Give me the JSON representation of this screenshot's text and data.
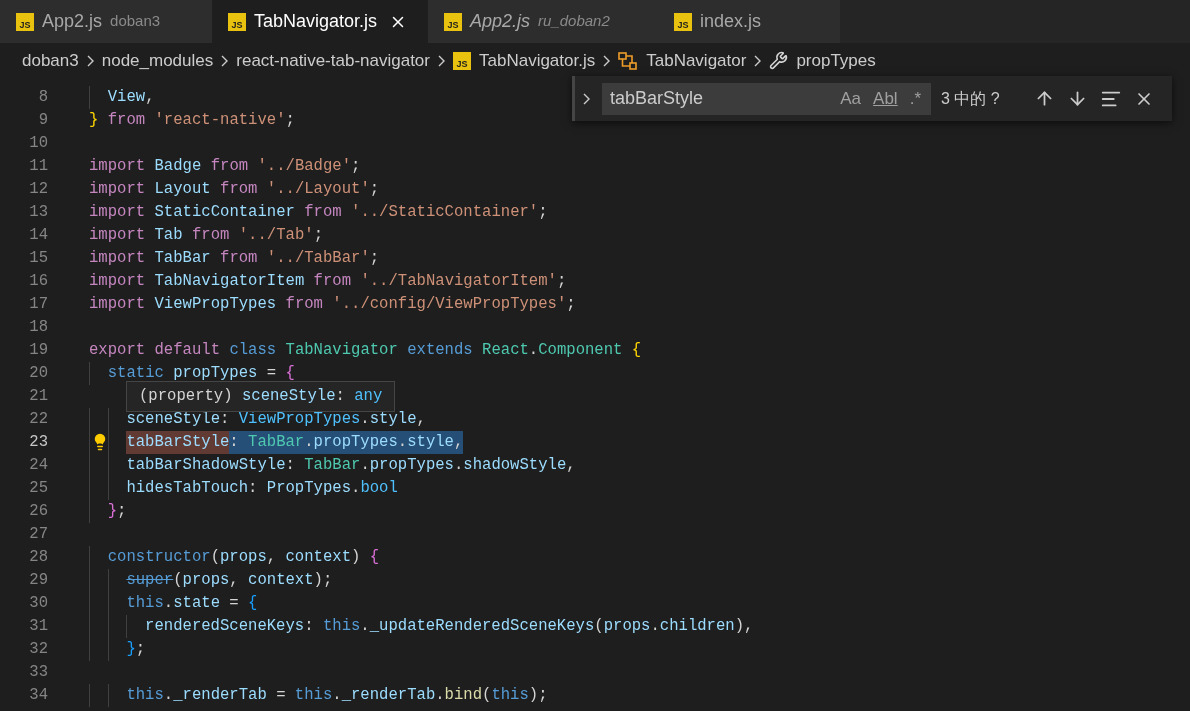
{
  "tabs": [
    {
      "label": "App2.js",
      "description": "doban3",
      "badge": "JS",
      "selected": false,
      "preview": false
    },
    {
      "label": "TabNavigator.js",
      "badge": "JS",
      "selected": true,
      "preview": false
    },
    {
      "label": "App2.js",
      "description": "ru_doban2",
      "badge": "JS",
      "selected": false,
      "preview": true
    },
    {
      "label": "index.js",
      "badge": "JS",
      "selected": false,
      "preview": false
    }
  ],
  "breadcrumb": [
    {
      "kind": "folder",
      "label": "doban3"
    },
    {
      "kind": "folder",
      "label": "node_modules"
    },
    {
      "kind": "folder",
      "label": "react-native-tab-navigator"
    },
    {
      "kind": "file",
      "label": "TabNavigator.js",
      "badge": "JS"
    },
    {
      "kind": "class",
      "label": "TabNavigator"
    },
    {
      "kind": "property",
      "label": "propTypes"
    }
  ],
  "find_widget": {
    "value": "tabBarStyle",
    "options": [
      "Aa",
      "Abl",
      ".*"
    ],
    "result": "3 中的 ?"
  },
  "lines": [
    {
      "number": "8",
      "current": false,
      "tokens": [
        {
          "kind": "variable",
          "text": "  View"
        },
        {
          "kind": "plain",
          "text": ","
        }
      ]
    },
    {
      "number": "9",
      "current": false,
      "tokens": [
        {
          "kind": "bracket1",
          "text": "} "
        },
        {
          "kind": "keyword",
          "text": "from "
        },
        {
          "kind": "string",
          "text": "'react-native'"
        },
        {
          "kind": "plain",
          "text": ";"
        }
      ]
    },
    {
      "number": "10",
      "current": false
    },
    {
      "number": "11",
      "current": false,
      "tokens": [
        {
          "kind": "keyword",
          "text": "import "
        },
        {
          "kind": "variable",
          "text": "Badge "
        },
        {
          "kind": "keyword",
          "text": "from "
        },
        {
          "kind": "string",
          "text": "'../Badge'"
        },
        {
          "kind": "plain",
          "text": ";"
        }
      ]
    },
    {
      "number": "12",
      "current": false,
      "tokens": [
        {
          "kind": "keyword",
          "text": "import "
        },
        {
          "kind": "variable",
          "text": "Layout "
        },
        {
          "kind": "keyword",
          "text": "from "
        },
        {
          "kind": "string",
          "text": "'../Layout'"
        },
        {
          "kind": "plain",
          "text": ";"
        }
      ]
    },
    {
      "number": "13",
      "current": false,
      "tokens": [
        {
          "kind": "keyword",
          "text": "import "
        },
        {
          "kind": "variable",
          "text": "StaticContainer "
        },
        {
          "kind": "keyword",
          "text": "from "
        },
        {
          "kind": "string",
          "text": "'../StaticContainer'"
        },
        {
          "kind": "plain",
          "text": ";"
        }
      ]
    },
    {
      "number": "14",
      "current": false,
      "tokens": [
        {
          "kind": "keyword",
          "text": "import "
        },
        {
          "kind": "variable",
          "text": "Tab "
        },
        {
          "kind": "keyword",
          "text": "from "
        },
        {
          "kind": "string",
          "text": "'../Tab'"
        },
        {
          "kind": "plain",
          "text": ";"
        }
      ]
    },
    {
      "number": "15",
      "current": false,
      "tokens": [
        {
          "kind": "keyword",
          "text": "import "
        },
        {
          "kind": "variable",
          "text": "TabBar "
        },
        {
          "kind": "keyword",
          "text": "from "
        },
        {
          "kind": "string",
          "text": "'../TabBar'"
        },
        {
          "kind": "plain",
          "text": ";"
        }
      ]
    },
    {
      "number": "16",
      "current": false,
      "tokens": [
        {
          "kind": "keyword",
          "text": "import "
        },
        {
          "kind": "variable",
          "text": "TabNavigatorItem "
        },
        {
          "kind": "keyword",
          "text": "from "
        },
        {
          "kind": "string",
          "text": "'../TabNavigatorItem'"
        },
        {
          "kind": "plain",
          "text": ";"
        }
      ]
    },
    {
      "number": "17",
      "current": false,
      "tokens": [
        {
          "kind": "keyword",
          "text": "import "
        },
        {
          "kind": "variable",
          "text": "ViewPropTypes "
        },
        {
          "kind": "keyword",
          "text": "from "
        },
        {
          "kind": "string",
          "text": "'../config/ViewPropTypes'"
        },
        {
          "kind": "plain",
          "text": ";"
        }
      ]
    },
    {
      "number": "18",
      "current": false
    },
    {
      "number": "19",
      "current": false,
      "tokens": [
        {
          "kind": "keyword",
          "text": "export default "
        },
        {
          "kind": "storage",
          "text": "class "
        },
        {
          "kind": "type",
          "text": "TabNavigator "
        },
        {
          "kind": "storage",
          "text": "extends "
        },
        {
          "kind": "type",
          "text": "React"
        },
        {
          "kind": "plain",
          "text": "."
        },
        {
          "kind": "type",
          "text": "Component "
        },
        {
          "kind": "bracket1",
          "text": "{"
        }
      ]
    },
    {
      "number": "20",
      "current": false,
      "tokens": [
        {
          "kind": "storage",
          "text": "  static "
        },
        {
          "kind": "variable",
          "text": "propTypes"
        },
        {
          "kind": "plain",
          "text": " = "
        },
        {
          "kind": "bracket2",
          "text": "{"
        }
      ]
    },
    {
      "number": "21",
      "current": false,
      "hover": [
        {
          "kind": "plain",
          "text": "(property) "
        },
        {
          "kind": "variable",
          "text": "sceneStyle"
        },
        {
          "kind": "plain",
          "text": ": "
        },
        {
          "kind": "constant",
          "text": "any"
        }
      ]
    },
    {
      "number": "22",
      "current": false,
      "tokens": [
        {
          "kind": "variable",
          "text": "    sceneStyle"
        },
        {
          "kind": "plain",
          "text": ": "
        },
        {
          "kind": "constant",
          "text": "ViewPropTypes"
        },
        {
          "kind": "plain",
          "text": "."
        },
        {
          "kind": "variable",
          "text": "style"
        },
        {
          "kind": "plain",
          "text": ","
        }
      ]
    },
    {
      "number": "23",
      "current": true,
      "lightbulb": true,
      "tokens": [
        {
          "kind": "variable",
          "text": "    tabBarStyle",
          "find_match": true,
          "selected": true
        },
        {
          "kind": "plain",
          "text": ": ",
          "find_match": false,
          "selected": true
        },
        {
          "kind": "type",
          "text": "TabBar",
          "find_match": false,
          "selected": true
        },
        {
          "kind": "plain",
          "text": ".",
          "find_match": false,
          "selected": true
        },
        {
          "kind": "variable",
          "text": "propTypes",
          "find_match": false,
          "selected": true
        },
        {
          "kind": "plain",
          "text": ".",
          "find_match": false,
          "selected": true
        },
        {
          "kind": "variable",
          "text": "style",
          "find_match": false,
          "selected": true
        },
        {
          "kind": "plain",
          "text": ",",
          "find_match": false,
          "selected": true
        }
      ]
    },
    {
      "number": "24",
      "current": false,
      "tokens": [
        {
          "kind": "variable",
          "text": "    tabBarShadowStyle"
        },
        {
          "kind": "plain",
          "text": ": "
        },
        {
          "kind": "type",
          "text": "TabBar"
        },
        {
          "kind": "plain",
          "text": "."
        },
        {
          "kind": "variable",
          "text": "propTypes"
        },
        {
          "kind": "plain",
          "text": "."
        },
        {
          "kind": "variable",
          "text": "shadowStyle"
        },
        {
          "kind": "plain",
          "text": ","
        }
      ]
    },
    {
      "number": "25",
      "current": false,
      "tokens": [
        {
          "kind": "variable",
          "text": "    hidesTabTouch"
        },
        {
          "kind": "plain",
          "text": ": "
        },
        {
          "kind": "variable",
          "text": "PropTypes"
        },
        {
          "kind": "plain",
          "text": "."
        },
        {
          "kind": "constant",
          "text": "bool"
        }
      ]
    },
    {
      "number": "26",
      "current": false,
      "tokens": [
        {
          "kind": "bracket2",
          "text": "  }"
        },
        {
          "kind": "plain",
          "text": ";"
        }
      ]
    },
    {
      "number": "27",
      "current": false
    },
    {
      "number": "28",
      "current": false,
      "tokens": [
        {
          "kind": "storage",
          "text": "  constructor"
        },
        {
          "kind": "plain",
          "text": "("
        },
        {
          "kind": "variable",
          "text": "props"
        },
        {
          "kind": "plain",
          "text": ", "
        },
        {
          "kind": "variable",
          "text": "context"
        },
        {
          "kind": "plain",
          "text": ") "
        },
        {
          "kind": "bracket2",
          "text": "{"
        }
      ]
    },
    {
      "number": "29",
      "current": false,
      "tokens": [
        {
          "kind": "deprecated",
          "text": "    super"
        },
        {
          "kind": "plain",
          "text": "("
        },
        {
          "kind": "variable",
          "text": "props"
        },
        {
          "kind": "plain",
          "text": ", "
        },
        {
          "kind": "variable",
          "text": "context"
        },
        {
          "kind": "plain",
          "text": ");"
        }
      ]
    },
    {
      "number": "30",
      "current": false,
      "tokens": [
        {
          "kind": "storage",
          "text": "    this"
        },
        {
          "kind": "plain",
          "text": "."
        },
        {
          "kind": "variable",
          "text": "state"
        },
        {
          "kind": "plain",
          "text": " = "
        },
        {
          "kind": "bracket3",
          "text": "{"
        }
      ]
    },
    {
      "number": "31",
      "current": false,
      "tokens": [
        {
          "kind": "variable",
          "text": "      renderedSceneKeys"
        },
        {
          "kind": "plain",
          "text": ": "
        },
        {
          "kind": "storage",
          "text": "this"
        },
        {
          "kind": "plain",
          "text": "."
        },
        {
          "kind": "variable",
          "text": "_updateRenderedSceneKeys"
        },
        {
          "kind": "plain",
          "text": "("
        },
        {
          "kind": "variable",
          "text": "props"
        },
        {
          "kind": "plain",
          "text": "."
        },
        {
          "kind": "variable",
          "text": "children"
        },
        {
          "kind": "plain",
          "text": "),"
        }
      ]
    },
    {
      "number": "32",
      "current": false,
      "tokens": [
        {
          "kind": "bracket3",
          "text": "    }"
        },
        {
          "kind": "plain",
          "text": ";"
        }
      ]
    },
    {
      "number": "33",
      "current": false
    },
    {
      "number": "34",
      "current": false,
      "tokens": [
        {
          "kind": "storage",
          "text": "    this"
        },
        {
          "kind": "plain",
          "text": "."
        },
        {
          "kind": "variable",
          "text": "_renderTab"
        },
        {
          "kind": "plain",
          "text": " = "
        },
        {
          "kind": "storage",
          "text": "this"
        },
        {
          "kind": "plain",
          "text": "."
        },
        {
          "kind": "variable",
          "text": "_renderTab"
        },
        {
          "kind": "plain",
          "text": "."
        },
        {
          "kind": "function",
          "text": "bind"
        },
        {
          "kind": "plain",
          "text": "("
        },
        {
          "kind": "storage",
          "text": "this"
        },
        {
          "kind": "plain",
          "text": ");"
        }
      ]
    }
  ]
}
